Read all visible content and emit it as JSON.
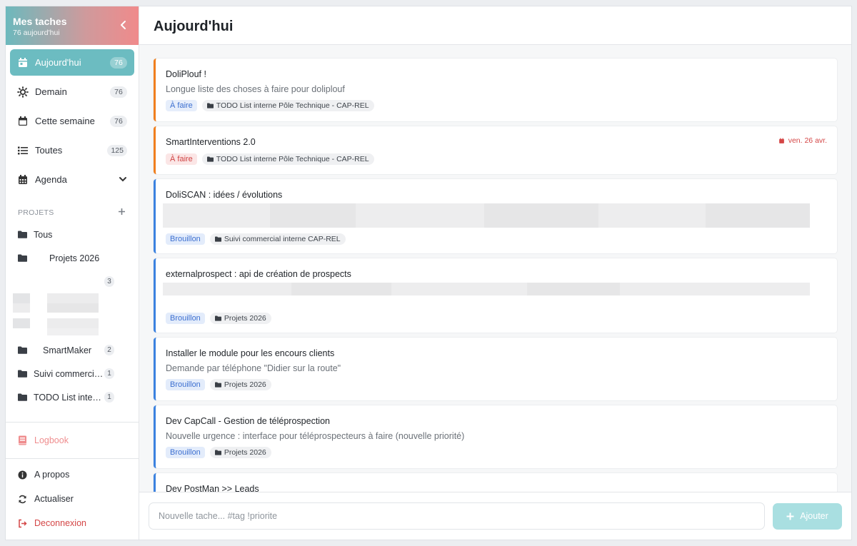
{
  "sidebar": {
    "title": "Mes taches",
    "subtitle": "76 aujourd'hui",
    "nav": [
      {
        "label": "Aujourd'hui",
        "count": "76",
        "icon": "calendar-day-icon"
      },
      {
        "label": "Demain",
        "count": "76",
        "icon": "sun-icon"
      },
      {
        "label": "Cette semaine",
        "count": "76",
        "icon": "calendar-week-icon"
      },
      {
        "label": "Toutes",
        "count": "125",
        "icon": "list-icon"
      },
      {
        "label": "Agenda",
        "icon": "calendar-grid-icon"
      }
    ],
    "projects_heading": "PROJETS",
    "projects": [
      {
        "label": "Tous"
      },
      {
        "label": "Projets 2026"
      },
      {
        "label": "",
        "count": "3"
      },
      {
        "label": "SmartMaker",
        "count": "2"
      },
      {
        "label": "Suivi commerci…",
        "count": "1"
      },
      {
        "label": "TODO List inte…",
        "count": "1"
      }
    ],
    "logbook": "Logbook",
    "bottom": {
      "about": "A propos",
      "refresh": "Actualiser",
      "logout": "Deconnexion"
    }
  },
  "main": {
    "title": "Aujourd'hui",
    "tasks": [
      {
        "title": "DoliPlouf !",
        "desc": "Longue liste des choses à faire pour doliplouf",
        "status": "À faire",
        "project": "TODO List interne Pôle Technique - CAP-REL"
      },
      {
        "title": "SmartInterventions 2.0",
        "status": "À faire",
        "project": "TODO List interne Pôle Technique - CAP-REL",
        "due": "ven. 26 avr."
      },
      {
        "title": "DoliSCAN : idées / évolutions",
        "status": "Brouillon",
        "project": "Suivi commercial interne CAP-REL"
      },
      {
        "title": "externalprospect : api de création de prospects",
        "status": "Brouillon",
        "project": "Projets 2026"
      },
      {
        "title": "Installer le module pour les encours clients",
        "desc": "Demande par téléphone \"Didier sur la route\"",
        "status": "Brouillon",
        "project": "Projets 2026"
      },
      {
        "title": "Dev CapCall - Gestion de téléprospection",
        "desc": "Nouvelle urgence : interface pour téléprospecteurs à faire (nouvelle priorité)",
        "status": "Brouillon",
        "project": "Projets 2026"
      },
      {
        "title": "Dev PostMan >> Leads"
      }
    ],
    "composer": {
      "placeholder": "Nouvelle tache... #tag !priorite",
      "add_label": "Ajouter"
    }
  },
  "colors": {
    "accent": "#6cbcc1",
    "orange_border": "#f07f1e",
    "blue_border": "#3b82e0",
    "danger": "#d44646"
  }
}
